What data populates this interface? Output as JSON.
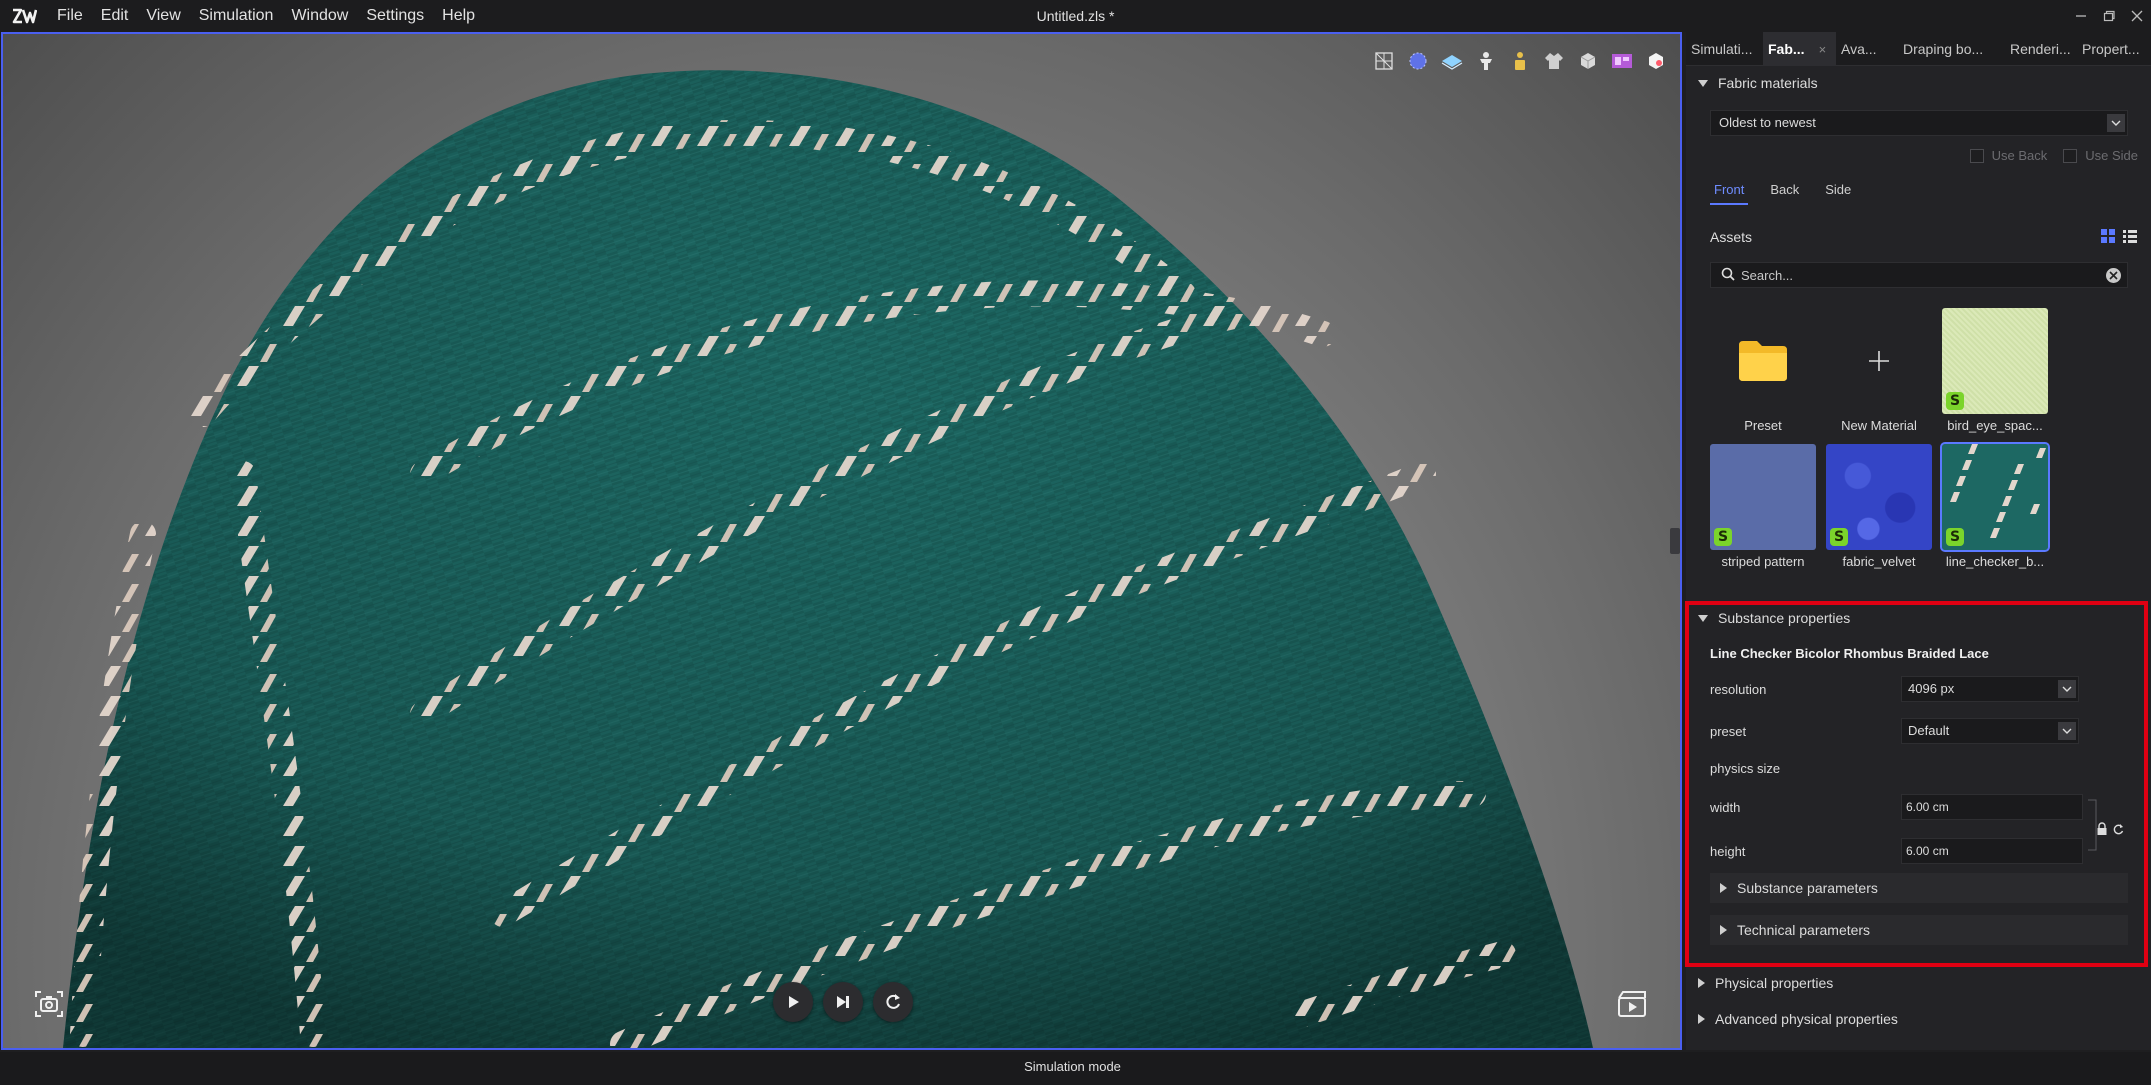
{
  "app": {
    "document_title": "Untitled.zls *",
    "menu": [
      "File",
      "Edit",
      "View",
      "Simulation",
      "Window",
      "Settings",
      "Help"
    ]
  },
  "viewport": {
    "toolbar_icons": [
      "wireframe-icon",
      "texture-sphere-icon",
      "fabric-layer-icon",
      "avatar-icon",
      "lock-avatar-icon",
      "garment-icon",
      "cube-icon",
      "uv-icon",
      "render-box-icon"
    ],
    "playback": [
      "play-icon",
      "step-forward-icon",
      "reset-icon"
    ],
    "fabric_color": "#1d6863",
    "lace_color": "#e3d6cc"
  },
  "status": {
    "mode": "Simulation mode"
  },
  "panel": {
    "tabs": [
      {
        "label": "Simulati...",
        "active": false
      },
      {
        "label": "Fab...",
        "active": true,
        "close": "×"
      },
      {
        "label": "Ava...",
        "active": false
      },
      {
        "label": "Draping bo...",
        "active": false
      },
      {
        "label": "Renderi...",
        "active": false
      },
      {
        "label": "Propert...",
        "active": false
      }
    ],
    "fabric_materials": {
      "header": "Fabric materials",
      "sort": "Oldest to newest",
      "use_back": "Use Back",
      "use_side": "Use Side",
      "side_tabs": [
        "Front",
        "Back",
        "Side"
      ],
      "assets_label": "Assets",
      "search_placeholder": "Search...",
      "assets": [
        {
          "label": "Preset"
        },
        {
          "label": "New Material"
        },
        {
          "label": "bird_eye_spac..."
        },
        {
          "label": "striped pattern"
        },
        {
          "label": "fabric_velvet"
        },
        {
          "label": "line_checker_b..."
        }
      ],
      "badge": "S"
    },
    "substance": {
      "header": "Substance properties",
      "title": "Line Checker Bicolor Rhombus Braided Lace",
      "resolution_label": "resolution",
      "resolution_value": "4096 px",
      "preset_label": "preset",
      "preset_value": "Default",
      "physics_size_label": "physics size",
      "width_label": "width",
      "width_value": "6.00 cm",
      "height_label": "height",
      "height_value": "6.00 cm",
      "substance_parameters": "Substance parameters",
      "technical_parameters": "Technical parameters"
    },
    "physical_properties": "Physical properties",
    "advanced_physical_properties": "Advanced physical properties"
  }
}
